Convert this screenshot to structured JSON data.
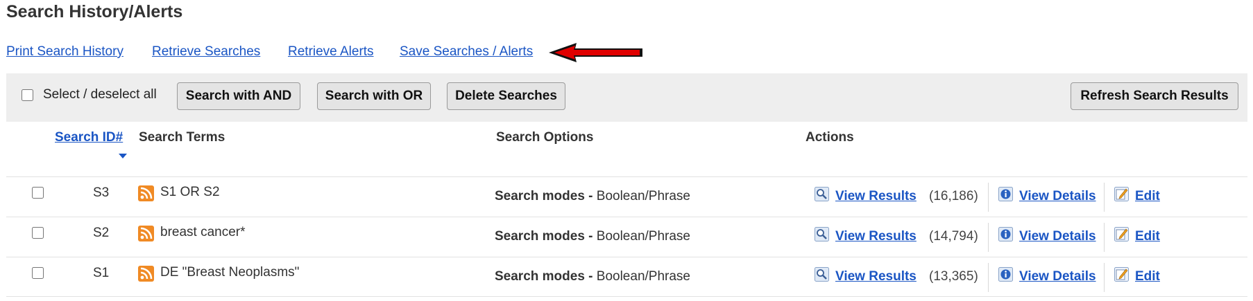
{
  "page": {
    "title": "Search History/Alerts"
  },
  "links": {
    "print": "Print Search History",
    "retrieve_searches": "Retrieve Searches",
    "retrieve_alerts": "Retrieve Alerts",
    "save": "Save Searches / Alerts"
  },
  "toolbar": {
    "select_all": "Select / deselect all",
    "search_and": "Search with AND",
    "search_or": "Search with OR",
    "delete": "Delete Searches",
    "refresh": "Refresh Search Results"
  },
  "table": {
    "headers": {
      "id": "Search ID#",
      "terms": "Search Terms",
      "options": "Search Options",
      "actions": "Actions"
    },
    "rows": [
      {
        "id": "S3",
        "terms": "S1 OR S2",
        "mode_label": "Search modes -",
        "mode_value": " Boolean/Phrase",
        "view": "View Results",
        "count": "(16,186)",
        "details": "View Details",
        "edit": "Edit"
      },
      {
        "id": "S2",
        "terms": "breast cancer*",
        "mode_label": "Search modes -",
        "mode_value": " Boolean/Phrase",
        "view": "View Results",
        "count": "(14,794)",
        "details": "View Details",
        "edit": "Edit"
      },
      {
        "id": "S1",
        "terms": "DE \"Breast Neoplasms\"",
        "mode_label": "Search modes -",
        "mode_value": " Boolean/Phrase",
        "view": "View Results",
        "count": "(13,365)",
        "details": "View Details",
        "edit": "Edit"
      }
    ]
  },
  "colors": {
    "link": "#1a55c4",
    "toolbar_bg": "#eeeeee",
    "rss": "#f08a24",
    "arrow": "#e00000"
  },
  "icons": {
    "rss": "rss-feed-icon",
    "view": "magnifier-icon",
    "details": "info-icon",
    "edit": "pencil-edit-icon",
    "arrow": "red-arrow-icon"
  }
}
